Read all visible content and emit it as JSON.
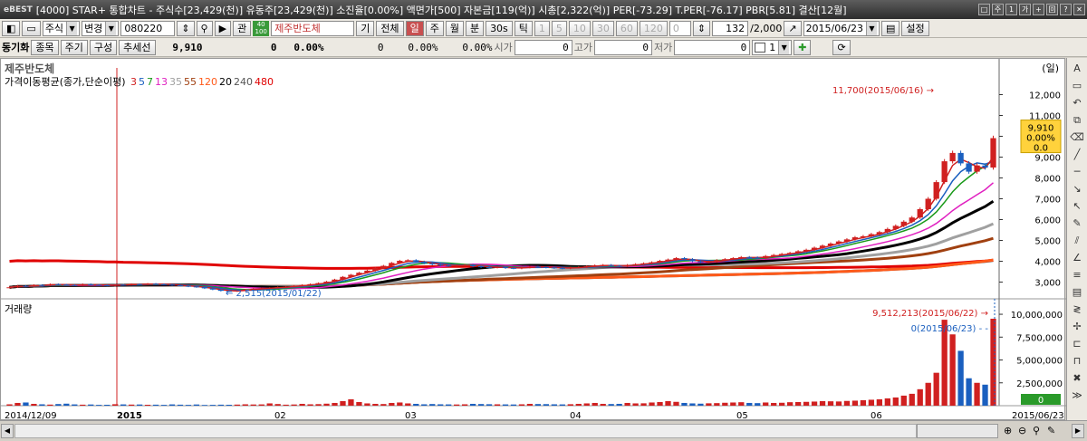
{
  "titlebar": {
    "logo": "eBEST",
    "title": "[4000] STAR+ 통합차트 - 주식수[23,429(천)] 유동주[23,429(천)] 소진율[0.00%] 액면가[500] 자본금[119(억)] 시총[2,322(억)] PER[-73.29] T.PER[-76.17] PBR[5.81] 결산[12월]",
    "buttons": [
      "□",
      "주",
      "1",
      "가",
      "+",
      "回",
      "?",
      "✕"
    ]
  },
  "toolbar1": {
    "market": "주식",
    "change": "변경",
    "code": "080220",
    "rel": "관",
    "badge_top": "40",
    "badge_bot": "100",
    "name": "제주반도체",
    "gi": "기",
    "all": "전체",
    "periods": [
      "일",
      "주",
      "월",
      "분",
      "30s",
      "틱"
    ],
    "active_period": "일",
    "num_btns": [
      "1",
      "5",
      "10",
      "30",
      "60",
      "120"
    ],
    "count_input": "0",
    "view_count": "132",
    "view_total": "/2,000",
    "date": "2015/06/23",
    "settings": "설정"
  },
  "toolbar2": {
    "sync": "동기화",
    "tabs": [
      "종목",
      "주기",
      "구성",
      "추세선"
    ],
    "price": "9,910",
    "change": "0",
    "rate": "0.00%",
    "volume": "0",
    "vol_rate": "0.00%",
    "vol_rate2": "0.00%",
    "open_label": "시가",
    "open": "0",
    "high_label": "고가",
    "high": "0",
    "low_label": "저가",
    "low": "0",
    "spin": "1"
  },
  "chart": {
    "stock_name": "제주반도체",
    "unit": "(일)",
    "ma_title": "가격이동평균(종가,단순이평)",
    "ma_periods": [
      {
        "label": "3",
        "color": "#d02020"
      },
      {
        "label": "5",
        "color": "#1a5fbf"
      },
      {
        "label": "7",
        "color": "#1a9a1a"
      },
      {
        "label": "13",
        "color": "#e020c0"
      },
      {
        "label": "35",
        "color": "#a0a0a0"
      },
      {
        "label": "55",
        "color": "#a04010"
      },
      {
        "label": "120",
        "color": "#ff5a1a"
      },
      {
        "label": "20",
        "color": "#000000"
      },
      {
        "label": "240",
        "color": "#555555"
      },
      {
        "label": "480",
        "color": "#e00000"
      }
    ],
    "volume_title": "거래량",
    "high_note": "11,700(2015/06/16)",
    "low_note": "2,515(2015/01/22)",
    "vol_max_note": "9,512,213(2015/06/22)",
    "vol_cur_note": "0(2015/06/23)",
    "current_box": [
      "9,910",
      "0.00%",
      "0.0"
    ],
    "current_vol_box": "0",
    "x_labels": [
      {
        "label": "2014/12/09",
        "bold": false
      },
      {
        "label": "2015",
        "bold": true
      },
      {
        "label": "02",
        "bold": false
      },
      {
        "label": "03",
        "bold": false
      },
      {
        "label": "04",
        "bold": false
      },
      {
        "label": "05",
        "bold": false
      },
      {
        "label": "06",
        "bold": false
      },
      {
        "label": "2015/06/23",
        "bold": false
      }
    ],
    "price_ticks": [
      "12,000",
      "11,000",
      "10,000",
      "9,000",
      "8,000",
      "7,000",
      "6,000",
      "5,000",
      "4,000",
      "3,000"
    ],
    "volume_ticks": [
      "10,000,000",
      "7,500,000",
      "5,000,000",
      "2,500,000"
    ]
  },
  "chart_data": {
    "type": "candlestick",
    "price_axis": {
      "min": 2500,
      "max": 12500
    },
    "volume_axis": {
      "min": 0,
      "max": 10500000
    },
    "series": [
      {
        "name": "price_close",
        "values": [
          2750,
          2820,
          2790,
          2860,
          2830,
          2900,
          2880,
          2860,
          2840,
          2900,
          2870,
          2850,
          2830,
          2870,
          2860,
          2900,
          2880,
          2920,
          2900,
          2880,
          2850,
          2820,
          2790,
          2760,
          2700,
          2640,
          2580,
          2560,
          2600,
          2640,
          2680,
          2700,
          2720,
          2760,
          2780,
          2820,
          2860,
          2900,
          2950,
          3020,
          3120,
          3250,
          3350,
          3450,
          3550,
          3680,
          3780,
          3920,
          4020,
          4050,
          3980,
          3900,
          3850,
          3800,
          3780,
          3800,
          3820,
          3760,
          3720,
          3700,
          3720,
          3680,
          3660,
          3700,
          3740,
          3720,
          3700,
          3680,
          3660,
          3700,
          3720,
          3760,
          3800,
          3820,
          3780,
          3760,
          3820,
          3860,
          3900,
          3950,
          4020,
          4080,
          4150,
          4100,
          4000,
          3950,
          3980,
          4050,
          4100,
          4150,
          4200,
          4180,
          4150,
          4250,
          4300,
          4350,
          4400,
          4480,
          4550,
          4650,
          4750,
          4850,
          4950,
          5050,
          5150,
          5200,
          5300,
          5400,
          5550,
          5700,
          5900,
          6100,
          6500,
          7000,
          7800,
          8800,
          9200,
          8700,
          8300,
          8600,
          8500,
          9910
        ]
      },
      {
        "name": "volume",
        "values": [
          150000,
          300000,
          350000,
          200000,
          150000,
          120000,
          180000,
          220000,
          140000,
          110000,
          130000,
          90000,
          100000,
          160000,
          140000,
          120000,
          130000,
          100000,
          110000,
          90000,
          140000,
          110000,
          90000,
          130000,
          80000,
          90000,
          110000,
          100000,
          120000,
          150000,
          130000,
          140000,
          250000,
          180000,
          110000,
          130000,
          200000,
          150000,
          170000,
          220000,
          300000,
          500000,
          700000,
          400000,
          250000,
          200000,
          180000,
          300000,
          350000,
          250000,
          200000,
          150000,
          180000,
          150000,
          140000,
          130000,
          150000,
          200000,
          180000,
          160000,
          150000,
          140000,
          130000,
          150000,
          200000,
          180000,
          170000,
          150000,
          140000,
          160000,
          200000,
          250000,
          300000,
          200000,
          180000,
          200000,
          300000,
          250000,
          260000,
          350000,
          400000,
          500000,
          420000,
          300000,
          250000,
          220000,
          260000,
          280000,
          320000,
          350000,
          380000,
          300000,
          280000,
          350000,
          300000,
          320000,
          380000,
          400000,
          420000,
          450000,
          500000,
          480000,
          460000,
          520000,
          550000,
          600000,
          650000,
          700000,
          800000,
          900000,
          1100000,
          1300000,
          1800000,
          2500000,
          3600000,
          9400000,
          7800000,
          6000000,
          3000000,
          2500000,
          2300000,
          9512213
        ]
      }
    ]
  }
}
